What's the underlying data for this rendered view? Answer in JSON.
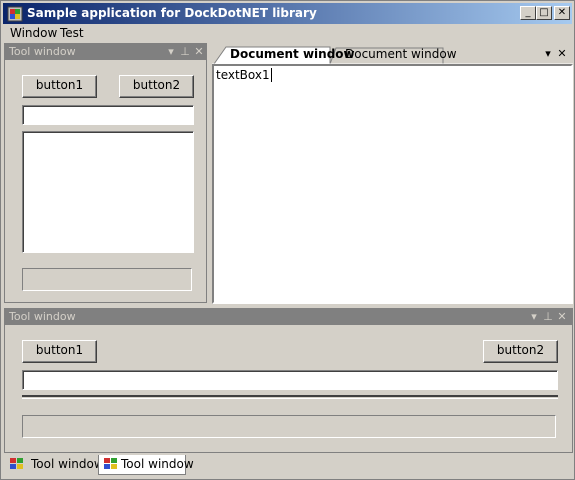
{
  "app": {
    "title": "Sample application for DockDotNET library",
    "caption_buttons": {
      "minimize": "_",
      "maximize": "□",
      "close": "✕"
    }
  },
  "menu": {
    "items": [
      "Window",
      "Test"
    ]
  },
  "left_tool_window": {
    "caption": "Tool window",
    "caption_icons": {
      "dropdown": "▾",
      "pin": "⊥",
      "close": "✕"
    },
    "button1": "button1",
    "button2": "button2"
  },
  "documents": {
    "tabs": [
      "Document window",
      "Document window"
    ],
    "active_index": 0,
    "tab_icons": {
      "dropdown": "▾",
      "close": "✕"
    },
    "textbox_value": "textBox1"
  },
  "bottom_tool_window": {
    "caption": "Tool window",
    "caption_icons": {
      "dropdown": "▾",
      "pin": "⊥",
      "close": "✕"
    },
    "button1": "button1",
    "button2": "button2"
  },
  "bottom_tabs": {
    "items": [
      "Tool window",
      "Tool window"
    ],
    "active_index": 1
  },
  "colors": {
    "title_start": "#0a246a",
    "title_end": "#a6caf0",
    "face": "#d4d0c8",
    "caption_inactive": "#808080"
  }
}
